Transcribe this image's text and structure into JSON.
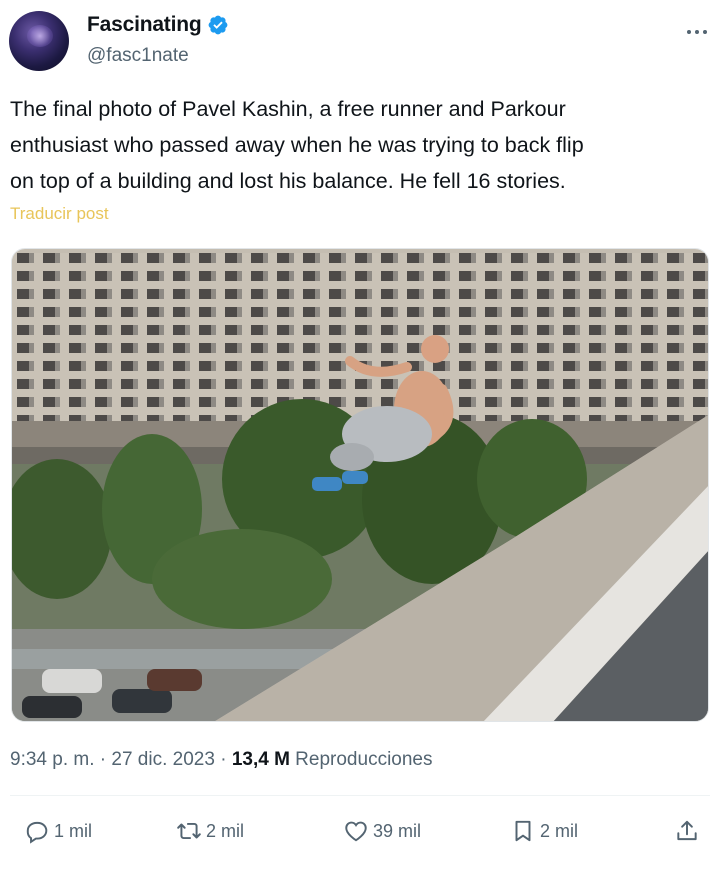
{
  "author": {
    "display_name": "Fascinating",
    "handle": "@fasc1nate",
    "avatar_icon": "galaxy-avatar",
    "verified_icon": "verified-badge-icon",
    "verified_color": "#1d9bf0"
  },
  "tweet": {
    "lines": [
      "The final photo of Pavel Kashin, a  free runner and Parkour",
      "enthusiast who passed away when he was trying to back flip",
      "on top of a building and lost his balance. He fell 16 stories."
    ],
    "translate_label": "Traducir post",
    "translate_color": "#e8c55a"
  },
  "meta": {
    "time": "9:34 p. m.",
    "sep1": " · ",
    "date": "27 dic. 2023",
    "sep2": " · ",
    "views": "13,4 M",
    "views_label": " Reproducciones"
  },
  "actions": {
    "reply": {
      "icon": "reply-icon",
      "count": "1 mil"
    },
    "repost": {
      "icon": "repost-icon",
      "count": "2 mil"
    },
    "like": {
      "icon": "heart-icon",
      "count": "39 mil"
    },
    "bookmark": {
      "icon": "bookmark-icon",
      "count": "2 mil"
    },
    "share": {
      "icon": "share-icon"
    }
  },
  "colors": {
    "text_primary": "#0f1419",
    "text_secondary": "#536471",
    "verified": "#1d9bf0"
  }
}
